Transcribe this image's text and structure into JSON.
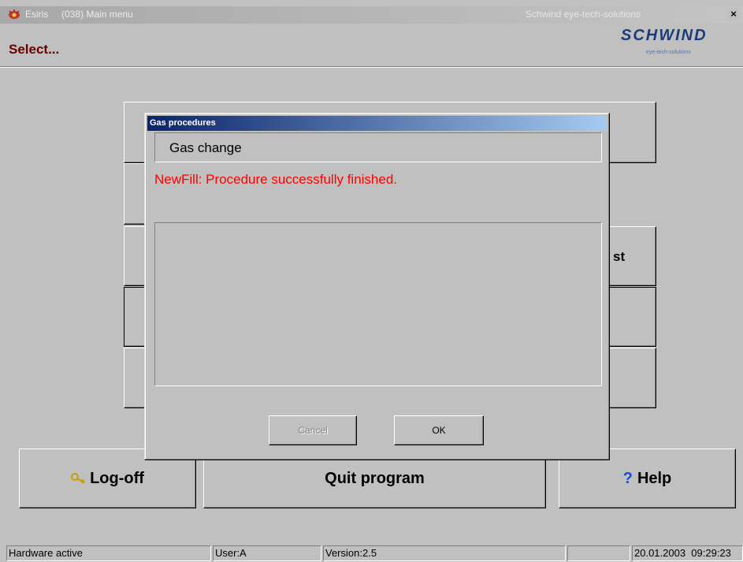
{
  "window": {
    "app_name": "Esiris",
    "title": "(038) Main menu",
    "vendor": "Schwind eye-tech-solutions",
    "close_glyph": "×"
  },
  "header": {
    "prompt": "Select...",
    "logo_text": "SCHWIND",
    "logo_tagline": "eye-tech-solutions"
  },
  "menu": {
    "partial_label": "st"
  },
  "bottom_buttons": {
    "logoff_label": "Log-off",
    "quit_label": "Quit program",
    "help_label": "Help",
    "help_glyph": "?"
  },
  "dialog": {
    "title": "Gas procedures",
    "section": "Gas change",
    "message": "NewFill: Procedure successfully finished.",
    "cancel_label": "Cancel",
    "ok_label": "OK"
  },
  "statusbar": {
    "hardware": "Hardware active",
    "user": "User:A",
    "version": "Version:2.5",
    "empty": "",
    "datetime": "20.01.2003  09:29:23"
  },
  "colors": {
    "select_text": "#6b0000",
    "message_text": "#ff0000",
    "help_icon": "#1a4bd6",
    "dialog_title_start": "#0a246a",
    "dialog_title_end": "#a6caf0"
  },
  "icons": {
    "app": "eye-logo-icon",
    "logoff": "key-icon",
    "help": "question-mark-icon"
  }
}
